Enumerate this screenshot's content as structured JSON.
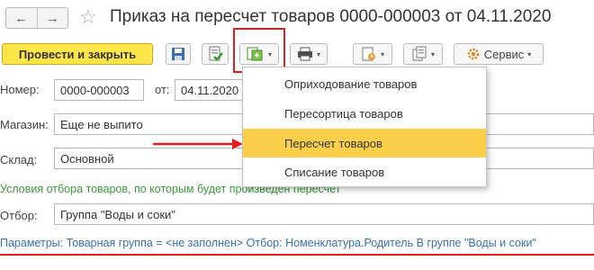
{
  "window": {
    "title": "Приказ на пересчет товаров 0000-000003 от 04.11.2020",
    "back_icon": "←",
    "forward_icon": "→",
    "star_icon": "☆"
  },
  "toolbar": {
    "post_and_close_label": "Провести и закрыть",
    "service_label": "Сервис",
    "caret": "▾"
  },
  "form": {
    "number_label": "Номер:",
    "number_value": "0000-000003",
    "date_label": "от:",
    "date_value": "04.11.2020",
    "store_label": "Магазин:",
    "store_value": "Еще не выпито",
    "warehouse_label": "Склад:",
    "warehouse_value": "Основной",
    "conditions_text": "Условия отбора товаров, по которым будет произведен пересчет",
    "filter_label": "Отбор:",
    "filter_value": "Группа \"Воды и соки\"",
    "parameters_text": "Параметры: Товарная группа = <не заполнен> Отбор: Номенклатура.Родитель В группе \"Воды и соки\""
  },
  "create_menu": {
    "items": [
      {
        "label": "Оприходование товаров"
      },
      {
        "label": "Пересортица товаров"
      },
      {
        "label": "Пересчет товаров"
      },
      {
        "label": "Списание товаров"
      }
    ],
    "selected_index": 2
  },
  "colors": {
    "primary_button": "#fde54a",
    "menu_highlight": "#fbcf49",
    "annotation_red": "#e02020",
    "green_text": "#3a9a3a",
    "param_text": "#3b6fb5"
  }
}
